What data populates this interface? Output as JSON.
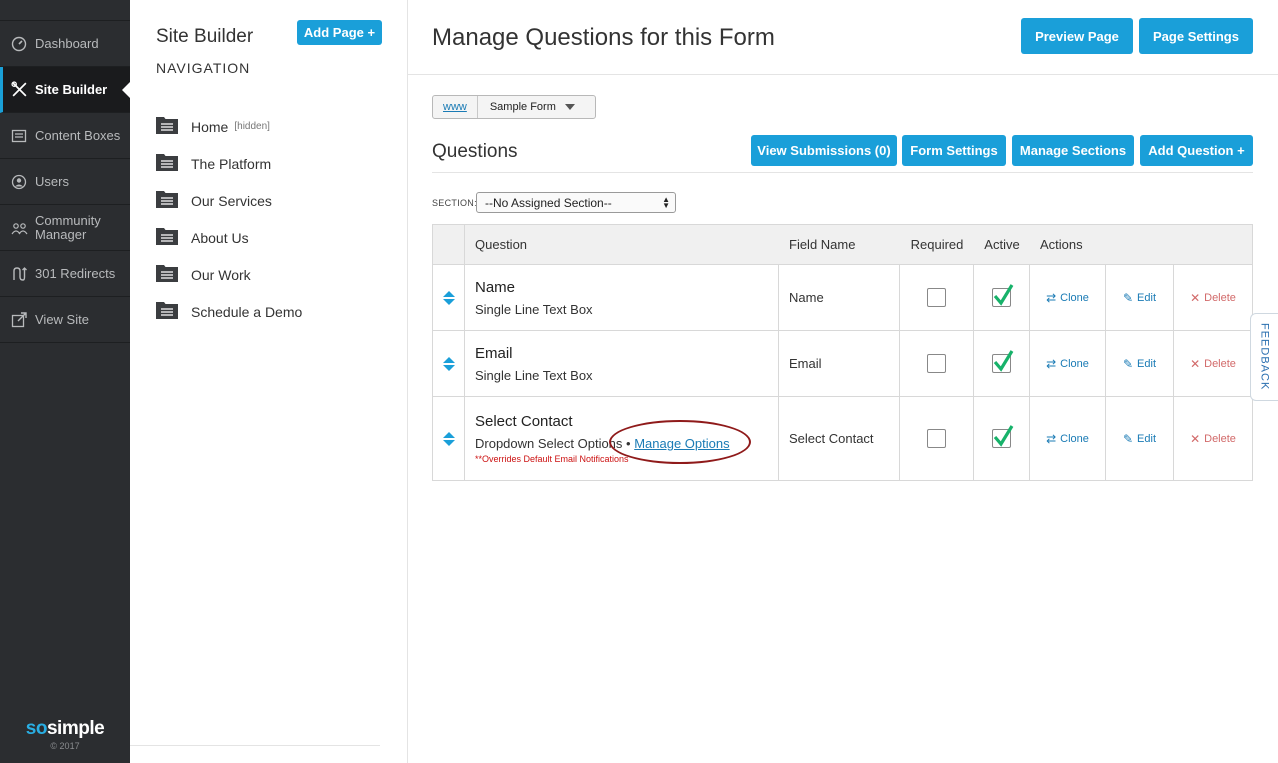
{
  "sidebar": {
    "items": [
      {
        "label": "Dashboard",
        "icon": "dashboard-icon"
      },
      {
        "label": "Site Builder",
        "icon": "tools-icon"
      },
      {
        "label": "Content Boxes",
        "icon": "content-boxes-icon"
      },
      {
        "label": "Users",
        "icon": "user-icon"
      },
      {
        "label": "Community Manager",
        "icon": "community-icon"
      },
      {
        "label": "301 Redirects",
        "icon": "redirect-icon"
      },
      {
        "label": "View Site",
        "icon": "external-link-icon"
      }
    ],
    "brand_so": "so",
    "brand_simple": "simple",
    "copyright": "© 2017"
  },
  "navpanel": {
    "title": "Site Builder",
    "add_page_label": "Add Page +",
    "subtitle": "NAVIGATION",
    "pages": [
      {
        "label": "Home",
        "tag": "[hidden]"
      },
      {
        "label": "The Platform"
      },
      {
        "label": "Our Services"
      },
      {
        "label": "About Us"
      },
      {
        "label": "Our Work"
      },
      {
        "label": "Schedule a Demo"
      }
    ]
  },
  "main": {
    "title": "Manage Questions for this Form",
    "preview_label": "Preview Page",
    "settings_label": "Page Settings",
    "breadcrumb": {
      "root": "www",
      "current": "Sample Form"
    },
    "questions_heading": "Questions",
    "buttons": {
      "view_submissions": "View Submissions (0)",
      "form_settings": "Form Settings",
      "manage_sections": "Manage Sections",
      "add_question": "Add Question +"
    },
    "section_label": "SECTION:",
    "section_value": "--No Assigned Section--",
    "table": {
      "headers": {
        "question": "Question",
        "field": "Field Name",
        "required": "Required",
        "active": "Active",
        "actions": "Actions"
      },
      "actions": {
        "clone": "Clone",
        "edit": "Edit",
        "delete": "Delete"
      },
      "rows": [
        {
          "name": "Name",
          "type": "Single Line Text Box",
          "field": "Name",
          "required": false,
          "active": true
        },
        {
          "name": "Email",
          "type": "Single Line Text Box",
          "field": "Email",
          "required": false,
          "active": true
        },
        {
          "name": "Select Contact",
          "type": "Dropdown Select Options",
          "separator": " • ",
          "link": "Manage Options",
          "note": "**Overrides Default Email Notifications",
          "field": "Select Contact",
          "required": false,
          "active": true
        }
      ]
    }
  },
  "feedback_label": "FEEDBACK",
  "colors": {
    "accent": "#1a9fd9",
    "sidebar_bg": "#2b2d30",
    "check": "#17b26a",
    "delete": "#d26a6a",
    "note": "#cc1111"
  }
}
